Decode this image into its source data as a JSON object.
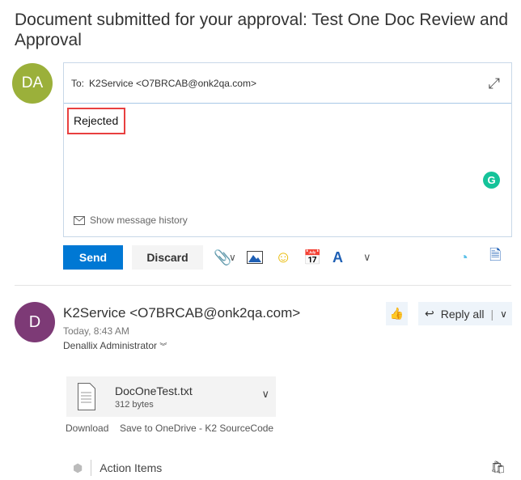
{
  "title": "Document submitted for your approval: Test One Doc Review and Approval",
  "compose": {
    "avatar_initials": "DA",
    "to_label": "To:",
    "to_value": "K2Service <O7BRCAB@onk2qa.com>",
    "body": "Rejected",
    "show_history": "Show message history",
    "send": "Send",
    "discard": "Discard"
  },
  "message": {
    "avatar_initial": "D",
    "sender": "K2Service <O7BRCAB@onk2qa.com>",
    "date": "Today, 8:43 AM",
    "recipient": "Denallix Administrator",
    "reply_all": "Reply all"
  },
  "attachment": {
    "name": "DocOneTest.txt",
    "size": "312 bytes",
    "download": "Download",
    "save": "Save to OneDrive - K2 SourceCode"
  },
  "action_items": "Action Items",
  "colors": {
    "accent": "#0078d4",
    "avatar_da": "#9bb03a",
    "avatar_d": "#7d3a76",
    "highlight": "#e84040"
  }
}
